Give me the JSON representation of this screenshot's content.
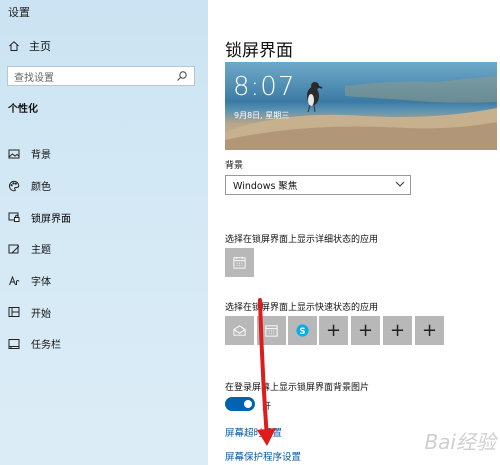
{
  "window": {
    "title": "设置"
  },
  "sidebar": {
    "home_label": "主页",
    "search_placeholder": "查找设置",
    "section_label": "个性化",
    "items": [
      {
        "label": "背景",
        "icon": "image-icon"
      },
      {
        "label": "颜色",
        "icon": "palette-icon"
      },
      {
        "label": "锁屏界面",
        "icon": "lock-screen-icon",
        "active": true
      },
      {
        "label": "主题",
        "icon": "brush-icon"
      },
      {
        "label": "字体",
        "icon": "font-icon"
      },
      {
        "label": "开始",
        "icon": "start-grid-icon"
      },
      {
        "label": "任务栏",
        "icon": "taskbar-icon"
      }
    ]
  },
  "main": {
    "title": "锁屏界面",
    "preview": {
      "time": "8:07",
      "date": "9月8日, 星期三"
    },
    "background_label": "背景",
    "background_dropdown_value": "Windows 聚焦",
    "detailed_status_label": "选择在锁屏界面上显示详细状态的应用",
    "quick_status_label": "选择在锁屏界面上显示快速状态的应用",
    "quick_status_apps": [
      "mail-icon",
      "calendar-icon",
      "skype-icon",
      "+",
      "+",
      "+",
      "+"
    ],
    "signin_bg_label": "在登录屏幕上显示锁屏界面背景图片",
    "signin_bg_toggle_state": "开",
    "screen_timeout_link": "屏幕超时设置",
    "screensaver_link": "屏幕保护程序设置"
  },
  "colors": {
    "accent": "#0063b1",
    "link": "#0b5aa2",
    "arrow": "#e01b1b"
  },
  "watermark": "Bai经验"
}
